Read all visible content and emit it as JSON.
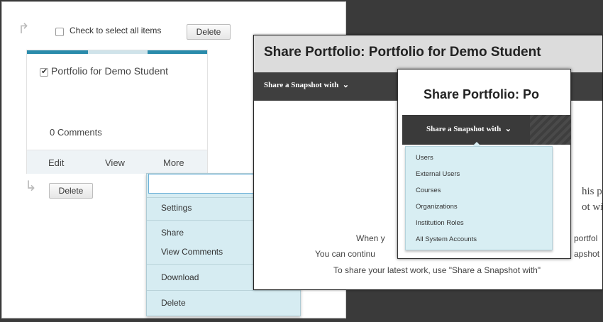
{
  "toolbar": {
    "select_all_label": "Check to select all items",
    "delete_label": "Delete"
  },
  "card": {
    "title": "Portfolio for Demo Student",
    "comments": "0 Comments",
    "actions": {
      "edit": "Edit",
      "view": "View",
      "more": "More"
    },
    "accent_color": "#2a8bab"
  },
  "bottom_toolbar": {
    "delete_label": "Delete"
  },
  "more_menu": {
    "items": [
      "Settings",
      "Share",
      "View Comments",
      "Download",
      "Delete"
    ]
  },
  "modal_back": {
    "title": "Share Portfolio: Portfolio for Demo Student",
    "share_label": "Share a Snapshot with",
    "serif_lines": [
      "his po",
      "ot wit"
    ],
    "body_lines": [
      "When y",
      "You can continu",
      "To share your latest work, use \"Share a Snapshot with\"",
      "portfol",
      "apshot"
    ]
  },
  "modal_front": {
    "title": "Share Portfolio: Po",
    "share_label": "Share a Snapshot with",
    "dropdown_items": [
      "Users",
      "External Users",
      "Courses",
      "Organizations",
      "Institution Roles",
      "All System Accounts"
    ]
  },
  "icons": {
    "return_arrow": "return-arrow-icon",
    "chevron": "chevron-down-icon"
  }
}
